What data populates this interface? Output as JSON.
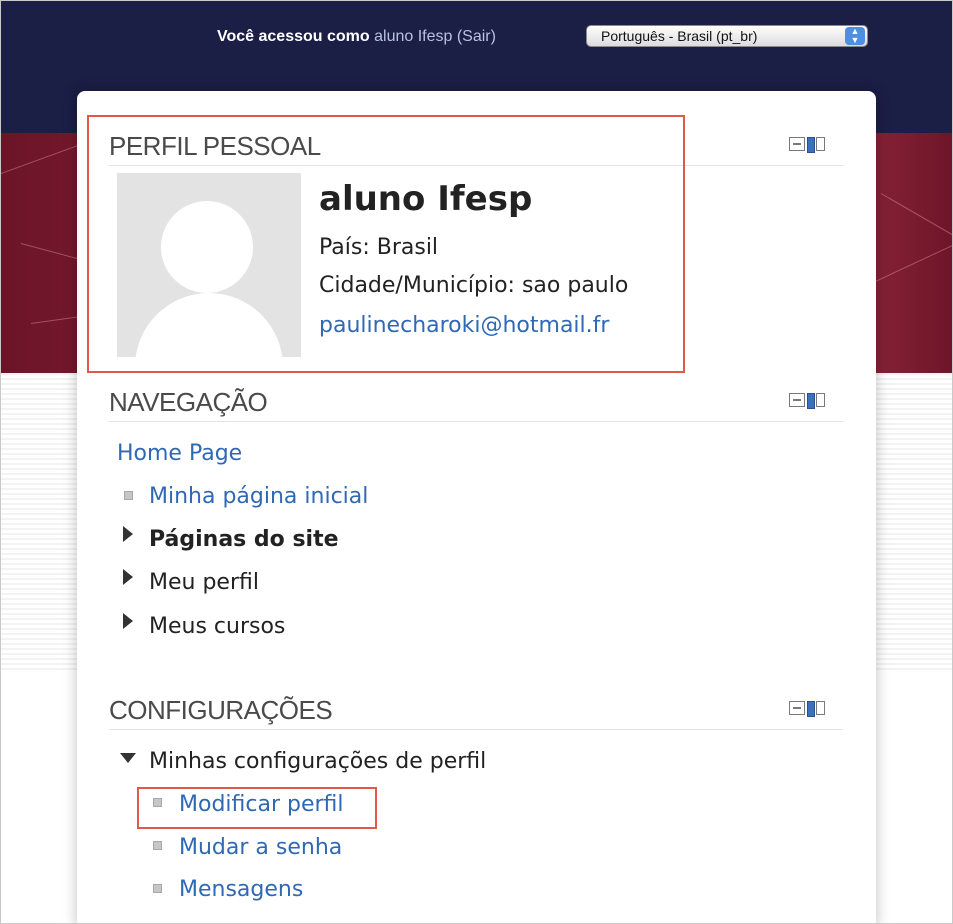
{
  "header": {
    "login_prefix": "Você acessou como",
    "user_name": "aluno Ifesp",
    "logout_open": "(",
    "logout_label": "Sair",
    "logout_close": ")",
    "language_selected": "Português - Brasil (pt_br)"
  },
  "profile_block": {
    "title": "PERFIL PESSOAL",
    "name": "aluno Ifesp",
    "country": "País: Brasil",
    "city": "Cidade/Município: sao paulo",
    "email": "paulinecharoki@hotmail.fr"
  },
  "navigation_block": {
    "title": "NAVEGAÇÃO",
    "home": "Home Page",
    "items": [
      {
        "label": "Minha página inicial"
      },
      {
        "label": "Páginas do site"
      },
      {
        "label": "Meu perfil"
      },
      {
        "label": "Meus cursos"
      }
    ]
  },
  "settings_block": {
    "title": "CONFIGURAÇÕES",
    "section_label": "Minhas configurações de perfil",
    "items": [
      {
        "label": "Modificar perfil"
      },
      {
        "label": "Mudar a senha"
      },
      {
        "label": "Mensagens"
      }
    ]
  },
  "colors": {
    "top_bar": "#1b1e45",
    "banner": "#7c1a30",
    "link": "#2f68b5",
    "highlight": "#e05a4a"
  },
  "icons": {
    "dock": "dock-block-icon",
    "bullet": "square-bullet-icon",
    "collapsed": "triangle-right-icon",
    "expanded": "triangle-down-icon",
    "select_arrows": "select-arrows-icon"
  }
}
